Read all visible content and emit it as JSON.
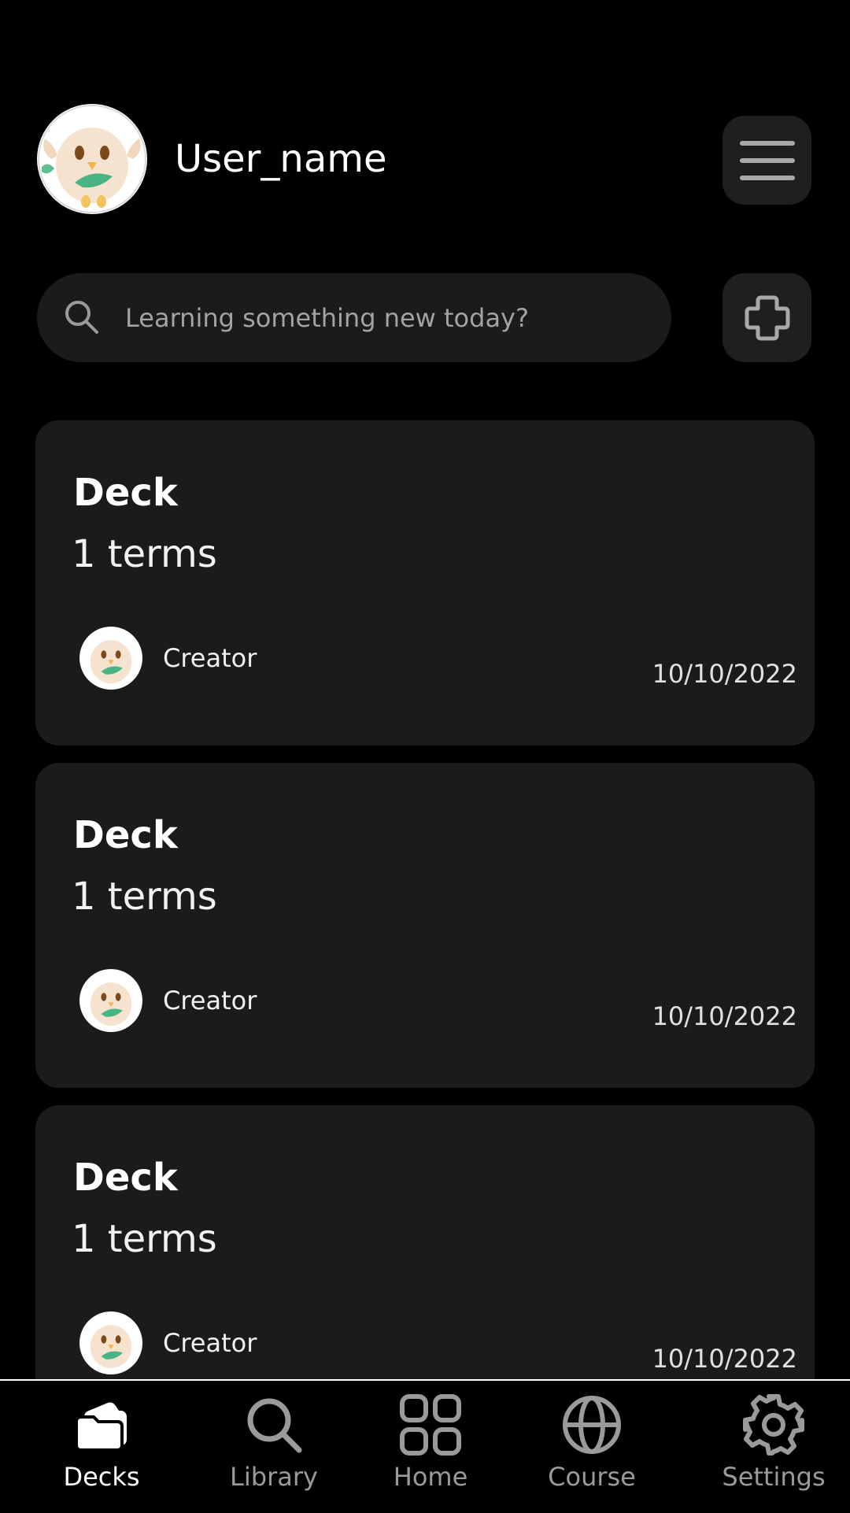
{
  "header": {
    "username": "User_name",
    "menu_icon": "hamburger-menu-icon"
  },
  "search": {
    "placeholder": "Learning something new today?",
    "icon": "search-icon"
  },
  "add_button": {
    "icon": "plus-icon"
  },
  "decks": [
    {
      "title": "Deck",
      "terms": "1 terms",
      "creator": "Creator",
      "date": "10/10/2022"
    },
    {
      "title": "Deck",
      "terms": "1 terms",
      "creator": "Creator",
      "date": "10/10/2022"
    },
    {
      "title": "Deck",
      "terms": "1 terms",
      "creator": "Creator",
      "date": "10/10/2022"
    }
  ],
  "nav": {
    "items": [
      {
        "label": "Decks",
        "icon": "folders-icon",
        "active": true
      },
      {
        "label": "Library",
        "icon": "search-icon",
        "active": false
      },
      {
        "label": "Home",
        "icon": "grid-icon",
        "active": false
      },
      {
        "label": "Course",
        "icon": "globe-icon",
        "active": false
      },
      {
        "label": "Settings",
        "icon": "gear-icon",
        "active": false
      }
    ]
  },
  "colors": {
    "background": "#000000",
    "card": "#1b1b1b",
    "button": "#1f1f1f",
    "inactive": "#9a9a9a",
    "active": "#ffffff"
  }
}
